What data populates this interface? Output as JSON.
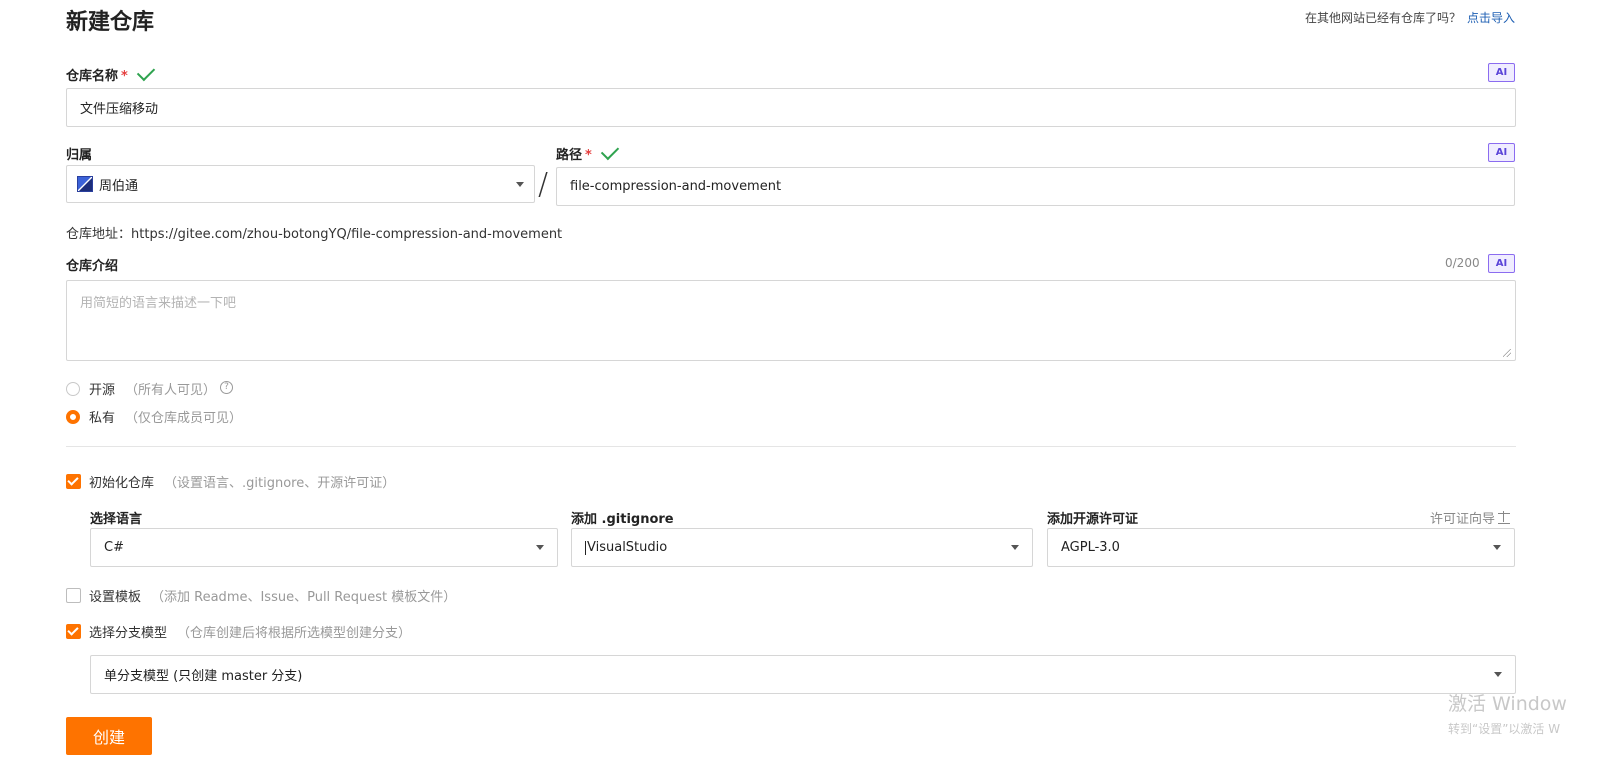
{
  "page": {
    "title": "新建仓库",
    "import_hint": "在其他网站已经有仓库了吗？",
    "import_link": "点击导入"
  },
  "ai_badge": "AI",
  "repo_name": {
    "label": "仓库名称",
    "required_mark": "*",
    "value": "文件压缩移动"
  },
  "owner": {
    "label": "归属",
    "value": "周伯通",
    "separator": "/"
  },
  "path": {
    "label": "路径",
    "required_mark": "*",
    "value": "file-compression-and-movement"
  },
  "repo_address": {
    "label": "仓库地址：",
    "url": "https://gitee.com/zhou-botongYQ/file-compression-and-movement"
  },
  "intro": {
    "label": "仓库介绍",
    "counter": "0/200",
    "placeholder": "用简短的语言来描述一下吧"
  },
  "visibility": {
    "options": [
      {
        "label": "开源",
        "note": "（所有人可见）",
        "selected": false
      },
      {
        "label": "私有",
        "note": "（仅仓库成员可见）",
        "selected": true
      }
    ],
    "help_icon": "?"
  },
  "init_repo": {
    "label": "初始化仓库",
    "note": "（设置语言、.gitignore、开源许可证）",
    "checked": true
  },
  "language": {
    "label": "选择语言",
    "value": "C#"
  },
  "gitignore": {
    "label": "添加 .gitignore",
    "value": "VisualStudio"
  },
  "license": {
    "label": "添加开源许可证",
    "guide": "许可证向导",
    "value": "AGPL-3.0"
  },
  "template": {
    "label": "设置模板",
    "note": "（添加 Readme、Issue、Pull Request 模板文件）",
    "checked": false
  },
  "branch_model": {
    "label": "选择分支模型",
    "note": "（仓库创建后将根据所选模型创建分支）",
    "checked": true,
    "value": "单分支模型 (只创建 master 分支)"
  },
  "create_button": "创建",
  "watermark": {
    "line1": "激活 Window",
    "line2": "转到“设置”以激活 W"
  },
  "colors": {
    "accent": "#fe7300",
    "link": "#1e5fb3",
    "valid": "#2fa34f",
    "required": "#e53e3e",
    "ai": "#5b45d8"
  }
}
